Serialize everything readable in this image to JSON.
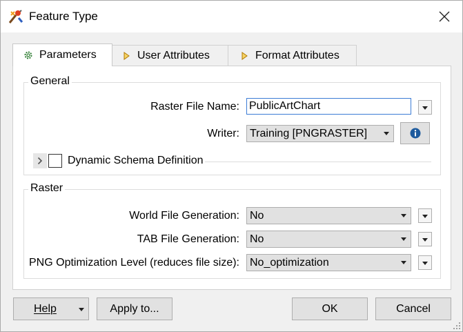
{
  "window": {
    "title": "Feature Type"
  },
  "tabs": [
    {
      "label": "Parameters",
      "icon": "gear-icon"
    },
    {
      "label": "User Attributes",
      "icon": "arrow-right-icon"
    },
    {
      "label": "Format Attributes",
      "icon": "arrow-right-icon"
    }
  ],
  "general": {
    "legend": "General",
    "raster_file_name": {
      "label": "Raster File Name:",
      "value": "PublicArtChart"
    },
    "writer": {
      "label": "Writer:",
      "value": "Training [PNGRASTER]"
    },
    "dynamic_schema": {
      "label": "Dynamic Schema Definition",
      "checked": false
    }
  },
  "raster": {
    "legend": "Raster",
    "world_file": {
      "label": "World File Generation:",
      "value": "No"
    },
    "tab_file": {
      "label": "TAB File Generation:",
      "value": "No"
    },
    "png_opt": {
      "label": "PNG Optimization Level (reduces file size):",
      "value": "No_optimization"
    }
  },
  "footer": {
    "help": "Help",
    "apply_to": "Apply to...",
    "ok": "OK",
    "cancel": "Cancel"
  },
  "colors": {
    "accent": "#3a7bd5",
    "info": "#1e5b9e"
  }
}
